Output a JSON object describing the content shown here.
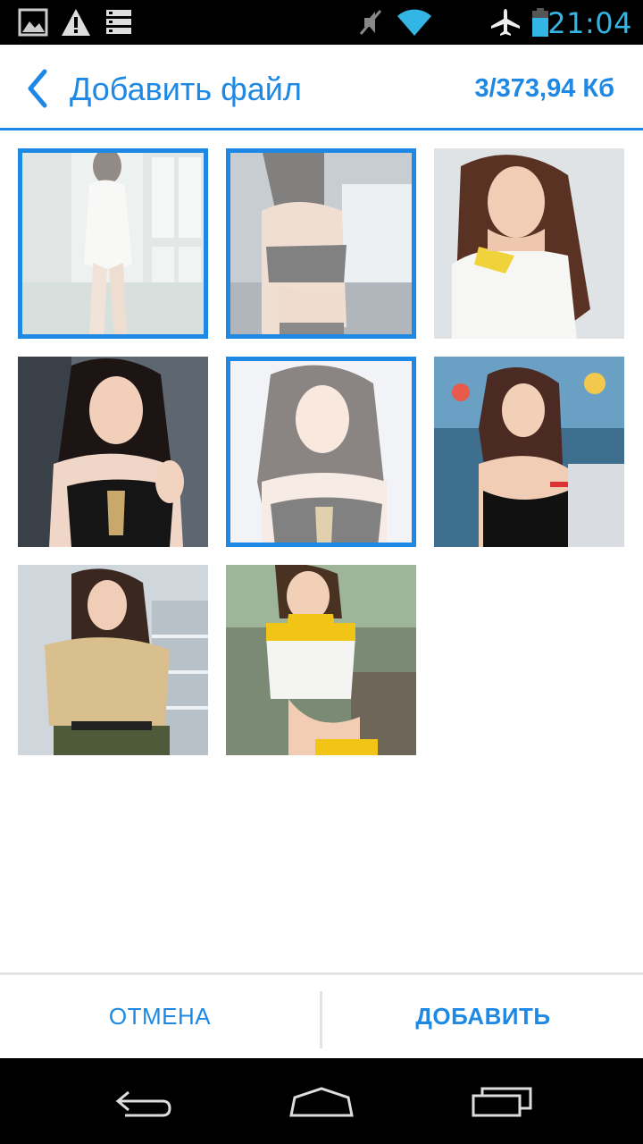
{
  "status_bar": {
    "time": "21:04",
    "left_icons": [
      "image-icon",
      "warning-icon",
      "sim-list-icon"
    ],
    "right_icons": [
      "mute-icon",
      "wifi-icon",
      "airplane-icon",
      "battery-icon"
    ],
    "accent": "#33b5e5"
  },
  "header": {
    "title": "Добавить файл",
    "counter": "3/373,94 Кб",
    "accent": "#1e88e5"
  },
  "gallery": {
    "photos": [
      {
        "selected": true
      },
      {
        "selected": true
      },
      {
        "selected": false
      },
      {
        "selected": false
      },
      {
        "selected": true
      },
      {
        "selected": false
      },
      {
        "selected": false
      },
      {
        "selected": false
      }
    ]
  },
  "actions": {
    "cancel_label": "ОТМЕНА",
    "add_label": "ДОБАВИТЬ"
  },
  "nav": {
    "icons": [
      "back-icon",
      "home-icon",
      "recents-icon"
    ]
  }
}
